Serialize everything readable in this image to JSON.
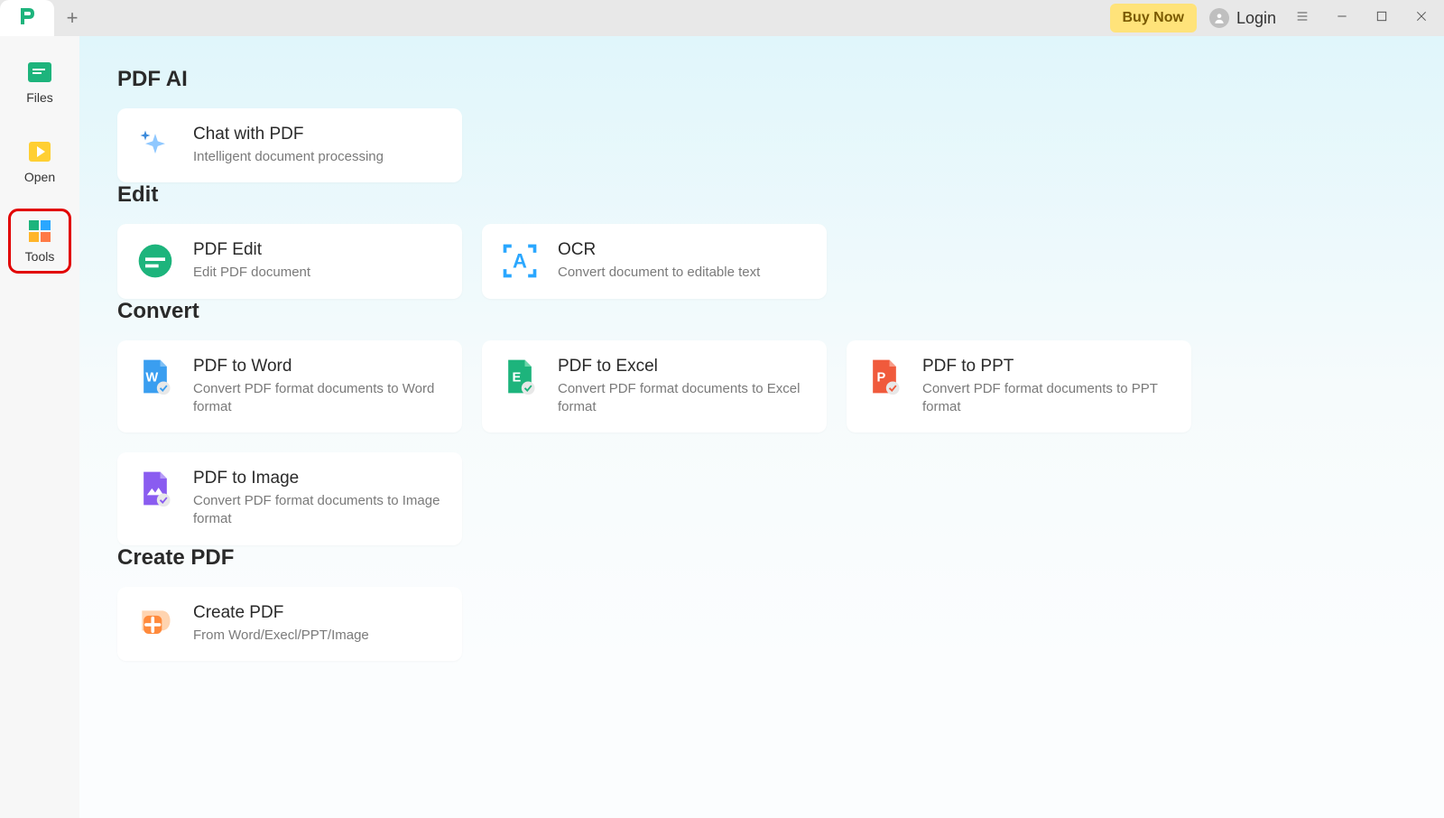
{
  "titlebar": {
    "buy_label": "Buy Now",
    "login_label": "Login"
  },
  "sidebar": {
    "items": [
      {
        "label": "Files"
      },
      {
        "label": "Open"
      },
      {
        "label": "Tools"
      }
    ]
  },
  "sections": {
    "pdf_ai": {
      "heading": "PDF AI",
      "cards": [
        {
          "title": "Chat with PDF",
          "sub": "Intelligent document processing"
        }
      ]
    },
    "edit": {
      "heading": "Edit",
      "cards": [
        {
          "title": "PDF Edit",
          "sub": "Edit PDF document"
        },
        {
          "title": "OCR",
          "sub": "Convert document to editable text"
        }
      ]
    },
    "convert": {
      "heading": "Convert",
      "cards": [
        {
          "title": "PDF to Word",
          "sub": "Convert PDF format documents to Word format"
        },
        {
          "title": "PDF to Excel",
          "sub": "Convert PDF format documents to Excel format"
        },
        {
          "title": "PDF to PPT",
          "sub": "Convert PDF format documents to PPT format"
        },
        {
          "title": "PDF to Image",
          "sub": "Convert PDF format documents to Image format"
        }
      ]
    },
    "create": {
      "heading": "Create PDF",
      "cards": [
        {
          "title": "Create PDF",
          "sub": "From Word/Execl/PPT/Image"
        }
      ]
    }
  }
}
